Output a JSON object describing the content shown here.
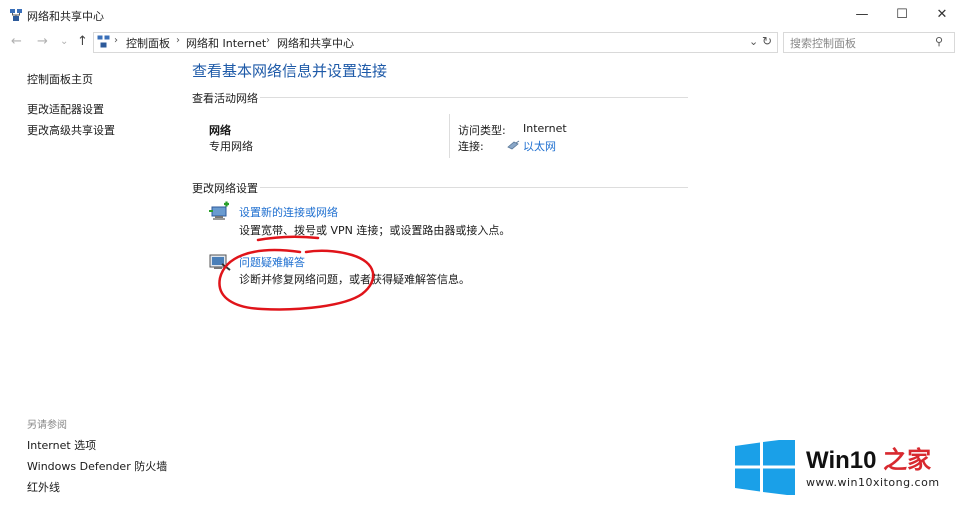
{
  "window": {
    "title": "网络和共享中心",
    "minimize_glyph": "—",
    "maximize_glyph": "☐",
    "close_glyph": "✕"
  },
  "nav": {
    "back_glyph": "←",
    "forward_glyph": "→",
    "recent_glyph": "⌄",
    "up_glyph": "↑",
    "breadcrumb": [
      "控制面板",
      "网络和 Internet",
      "网络和共享中心"
    ],
    "separator": "›",
    "dropdown_glyph": "⌄",
    "refresh_glyph": "↻",
    "search_placeholder": "搜索控制面板",
    "search_glyph": "⚲"
  },
  "sidebar": {
    "links": [
      "控制面板主页",
      "更改适配器设置",
      "更改高级共享设置"
    ],
    "see_also_label": "另请参阅",
    "see_also_links": [
      "Internet 选项",
      "Windows Defender 防火墙",
      "红外线"
    ]
  },
  "main": {
    "title": "查看基本网络信息并设置连接",
    "active_section": "查看活动网络",
    "network_name": "网络",
    "network_type": "专用网络",
    "access_type_label": "访问类型:",
    "access_type_value": "Internet",
    "connection_label": "连接:",
    "connection_value": "以太网",
    "change_section": "更改网络设置",
    "tasks": [
      {
        "link": "设置新的连接或网络",
        "desc": "设置宽带、拨号或 VPN 连接；或设置路由器或接入点。"
      },
      {
        "link": "问题疑难解答",
        "desc": "诊断并修复网络问题，或者获得疑难解答信息。"
      }
    ]
  },
  "annotation_color": "#e0141a",
  "link_color": "#1e6fd0",
  "title_color": "#1e5aa8",
  "watermark": {
    "brand_prefix": "Win10 ",
    "brand_suffix": "之家",
    "url": "www.win10xitong.com",
    "logo_color": "#1aa0e8",
    "suffix_color": "#d8292f"
  }
}
